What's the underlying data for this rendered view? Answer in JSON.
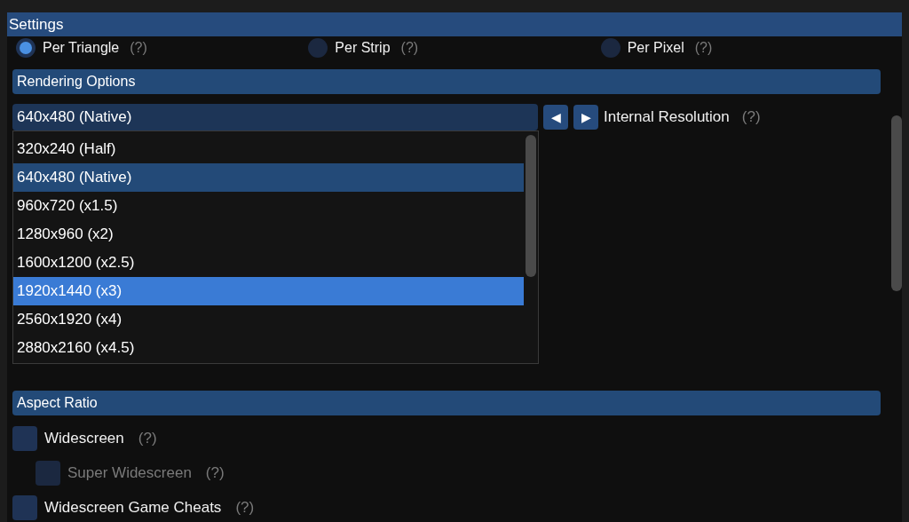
{
  "window": {
    "title": "Settings"
  },
  "shading_radios": [
    {
      "label": "Per Triangle",
      "help": "(?)",
      "selected": true
    },
    {
      "label": "Per Strip",
      "help": "(?)",
      "selected": false
    },
    {
      "label": "Per Pixel",
      "help": "(?)",
      "selected": false
    }
  ],
  "rendering_options": {
    "header": "Rendering Options",
    "resolution": {
      "value": "640x480 (Native)",
      "label": "Internal Resolution",
      "help": "(?)",
      "prev": "◀",
      "next": "▶",
      "options": [
        {
          "label": "320x240 (Half)",
          "selected": false,
          "hovered": false
        },
        {
          "label": "640x480 (Native)",
          "selected": true,
          "hovered": false
        },
        {
          "label": "960x720 (x1.5)",
          "selected": false,
          "hovered": false
        },
        {
          "label": "1280x960 (x2)",
          "selected": false,
          "hovered": false
        },
        {
          "label": "1600x1200 (x2.5)",
          "selected": false,
          "hovered": false
        },
        {
          "label": "1920x1440 (x3)",
          "selected": false,
          "hovered": true
        },
        {
          "label": "2560x1920 (x4)",
          "selected": false,
          "hovered": false
        },
        {
          "label": "2880x2160 (x4.5)",
          "selected": false,
          "hovered": false
        }
      ]
    }
  },
  "aspect_ratio": {
    "header": "Aspect Ratio",
    "checkboxes": [
      {
        "label": "Widescreen",
        "help": "(?)",
        "checked": false,
        "disabled": false,
        "children": [
          {
            "label": "Super Widescreen",
            "help": "(?)",
            "checked": false,
            "disabled": true
          }
        ]
      },
      {
        "label": "Widescreen Game Cheats",
        "help": "(?)",
        "checked": false,
        "disabled": false
      }
    ]
  }
}
